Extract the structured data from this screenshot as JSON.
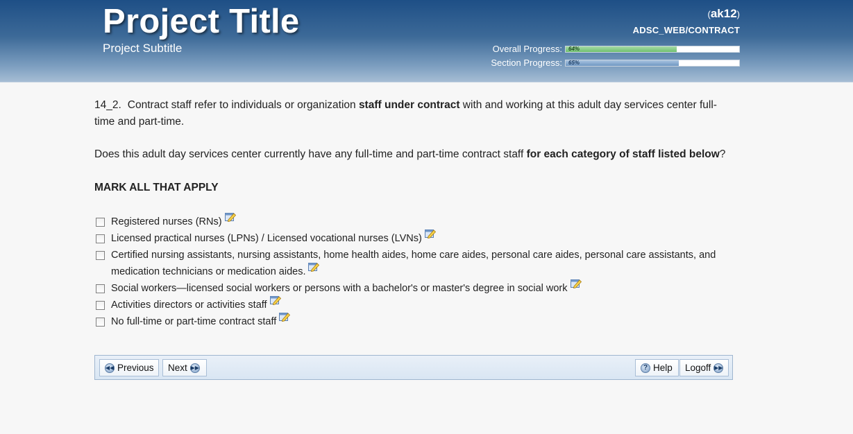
{
  "header": {
    "title": "Project Title",
    "subtitle": "Project Subtitle",
    "user_id": "ak12",
    "user_path": "ADSC_WEB/CONTRACT",
    "overall_label": "Overall Progress:",
    "overall_text": "64%",
    "overall_value": 64,
    "section_label": "Section Progress:",
    "section_text": "65%",
    "section_value": 65
  },
  "question": {
    "number": "14_2.",
    "intro_pre": "Contract staff refer to individuals or organization ",
    "intro_bold": "staff under contract",
    "intro_post": " with and working at this adult day services center full-time and part-time.",
    "prompt_pre": "Does this adult day services center currently have any full-time and part-time contract staff ",
    "prompt_bold": "for each category of staff listed below",
    "prompt_post": "?",
    "instruction": "MARK ALL THAT APPLY"
  },
  "options": [
    {
      "label": "Registered nurses (RNs)",
      "checked": false
    },
    {
      "label": "Licensed practical nurses (LPNs) / Licensed vocational nurses (LVNs)",
      "checked": false
    },
    {
      "label": "Certified nursing assistants, nursing assistants, home health aides, home care aides, personal care aides, personal care assistants, and medication technicians or medication aides.",
      "checked": false
    },
    {
      "label": "Social workers—licensed social workers or persons with a bachelor's or master's degree in social work",
      "checked": false
    },
    {
      "label": "Activities directors or activities staff",
      "checked": false
    },
    {
      "label": "No full-time or part-time contract staff",
      "checked": false
    }
  ],
  "nav": {
    "previous": "Previous",
    "next": "Next",
    "help": "Help",
    "logoff": "Logoff"
  },
  "icons": {
    "note": "note-edit-icon",
    "previous": "rewind-circle-icon",
    "next": "forward-circle-icon",
    "help": "help-circle-icon",
    "logoff": "forward-circle-icon"
  },
  "colors": {
    "header_top": "#1e4f86",
    "progress_overall": "#6fbf6f",
    "progress_section": "#6f97c2",
    "nav_border": "#9fb6cf"
  }
}
